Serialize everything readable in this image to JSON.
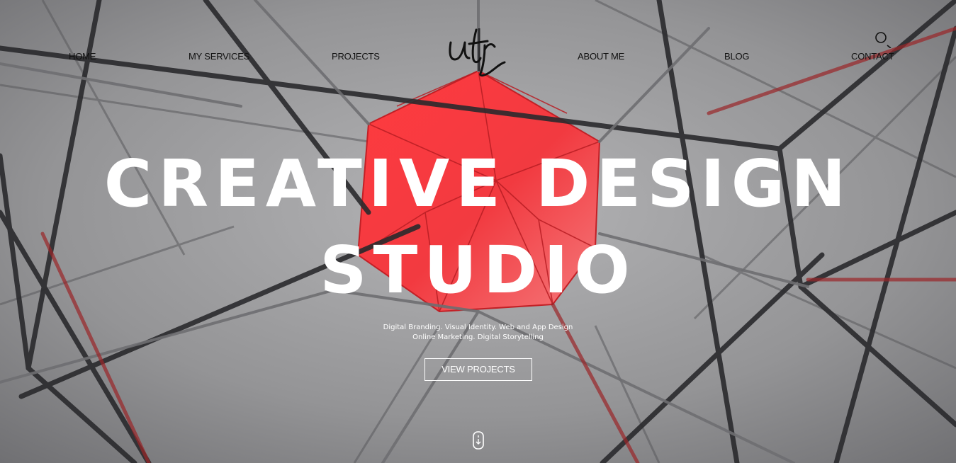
{
  "nav": {
    "home": "HOME",
    "services": "MY SERVICES",
    "projects": "PROJECTS",
    "about": "ABOUT ME",
    "blog": "BLOG",
    "contact": "CONTACT"
  },
  "logo": {
    "text": "utr",
    "icon": "script-logo"
  },
  "icons": {
    "search": "search-icon",
    "scroll": "scroll-down-icon"
  },
  "hero": {
    "headline_line1": "CREATIVE DESIGN",
    "headline_line2": "STUDIO",
    "tagline_line1": "Digital Branding. Visual Identity. Web and App Design",
    "tagline_line2": "Online Marketing. Digital Storytelling",
    "cta_label": "VIEW PROJECTS"
  },
  "colors": {
    "background": "#8f8f91",
    "accent": "#ee2f36",
    "text_light": "#ffffff",
    "text_dark": "#111111"
  }
}
